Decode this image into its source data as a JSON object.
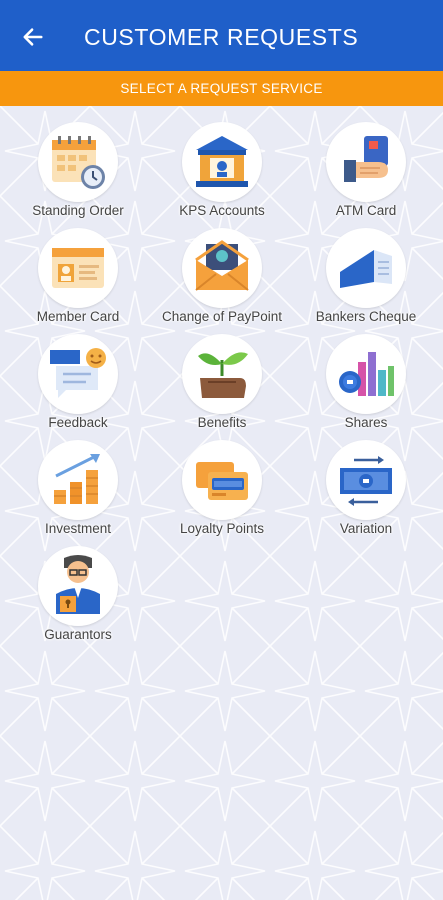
{
  "appbar": {
    "title": "CUSTOMER REQUESTS",
    "back_icon": "arrow-left-icon",
    "color": "#1f5fc9"
  },
  "subbar": {
    "text": "SELECT A REQUEST SERVICE",
    "color": "#f7960e"
  },
  "services": [
    {
      "label": "Standing Order",
      "icon": "calendar-clock-icon"
    },
    {
      "label": "KPS Accounts",
      "icon": "bank-building-icon"
    },
    {
      "label": "ATM Card",
      "icon": "hand-card-icon"
    },
    {
      "label": "Member Card",
      "icon": "id-card-icon"
    },
    {
      "label": "Change of PayPoint",
      "icon": "envelope-money-icon"
    },
    {
      "label": "Bankers Cheque",
      "icon": "cheque-icon"
    },
    {
      "label": "Feedback",
      "icon": "chat-smiley-icon"
    },
    {
      "label": "Benefits",
      "icon": "hand-plant-icon"
    },
    {
      "label": "Shares",
      "icon": "bar-chart-icon"
    },
    {
      "label": "Investment",
      "icon": "growth-chart-icon"
    },
    {
      "label": "Loyalty Points",
      "icon": "loyalty-cards-icon"
    },
    {
      "label": "Variation",
      "icon": "banknote-exchange-icon"
    },
    {
      "label": "Guarantors",
      "icon": "guarantor-person-icon"
    }
  ]
}
